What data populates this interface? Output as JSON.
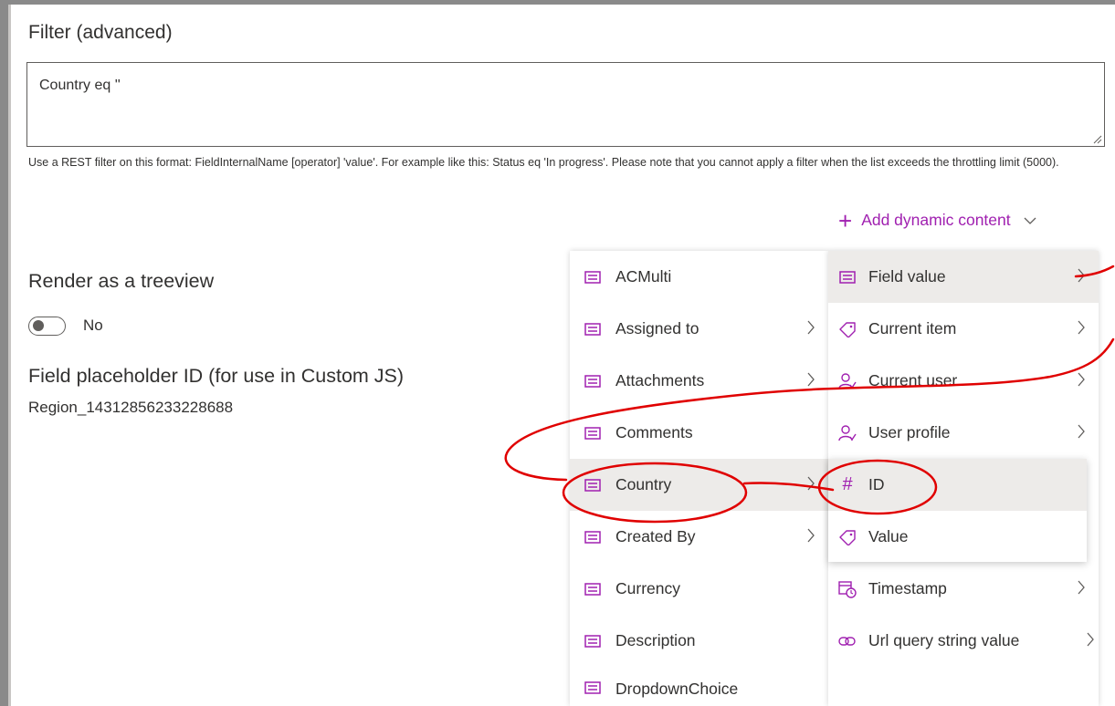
{
  "filter": {
    "label": "Filter (advanced)",
    "value": "Country eq ''",
    "help": "Use a REST filter on this format: FieldInternalName [operator] 'value'. For example like this: Status eq 'In progress'. Please note that you cannot apply a filter when the list exceeds the throttling limit (5000)."
  },
  "add_dynamic": {
    "label": "Add dynamic content"
  },
  "treeview": {
    "label": "Render as a treeview",
    "toggle_state": "No"
  },
  "placeholder": {
    "label": "Field placeholder ID (for use in Custom JS)",
    "value": "Region_14312856233228688"
  },
  "menu_left": {
    "items": [
      {
        "label": "ACMulti",
        "icon": "field-icon",
        "has_submenu": false
      },
      {
        "label": "Assigned to",
        "icon": "field-icon",
        "has_submenu": true
      },
      {
        "label": "Attachments",
        "icon": "field-icon",
        "has_submenu": true
      },
      {
        "label": "Comments",
        "icon": "field-icon",
        "has_submenu": false
      },
      {
        "label": "Country",
        "icon": "field-icon",
        "has_submenu": true
      },
      {
        "label": "Created By",
        "icon": "field-icon",
        "has_submenu": true
      },
      {
        "label": "Currency",
        "icon": "field-icon",
        "has_submenu": false
      },
      {
        "label": "Description",
        "icon": "field-icon",
        "has_submenu": false
      },
      {
        "label": "DropdownChoice",
        "icon": "field-icon",
        "has_submenu": false
      }
    ]
  },
  "menu_right": {
    "items": [
      {
        "label": "Field value",
        "icon": "field-icon",
        "has_submenu": true
      },
      {
        "label": "Current item",
        "icon": "tag-icon",
        "has_submenu": true
      },
      {
        "label": "Current user",
        "icon": "person-icon",
        "has_submenu": true
      },
      {
        "label": "User profile",
        "icon": "person-icon",
        "has_submenu": true
      },
      {
        "label": "Timestamp",
        "icon": "calendar-clock-icon",
        "has_submenu": true
      },
      {
        "label": "Url query string value",
        "icon": "link-icon",
        "has_submenu": true
      }
    ]
  },
  "submenu": {
    "items": [
      {
        "label": "ID",
        "icon": "hash-icon"
      },
      {
        "label": "Value",
        "icon": "tag-icon"
      }
    ]
  },
  "colors": {
    "accent": "#a020b0",
    "annotation": "#e00000",
    "hover": "#edebe9"
  }
}
